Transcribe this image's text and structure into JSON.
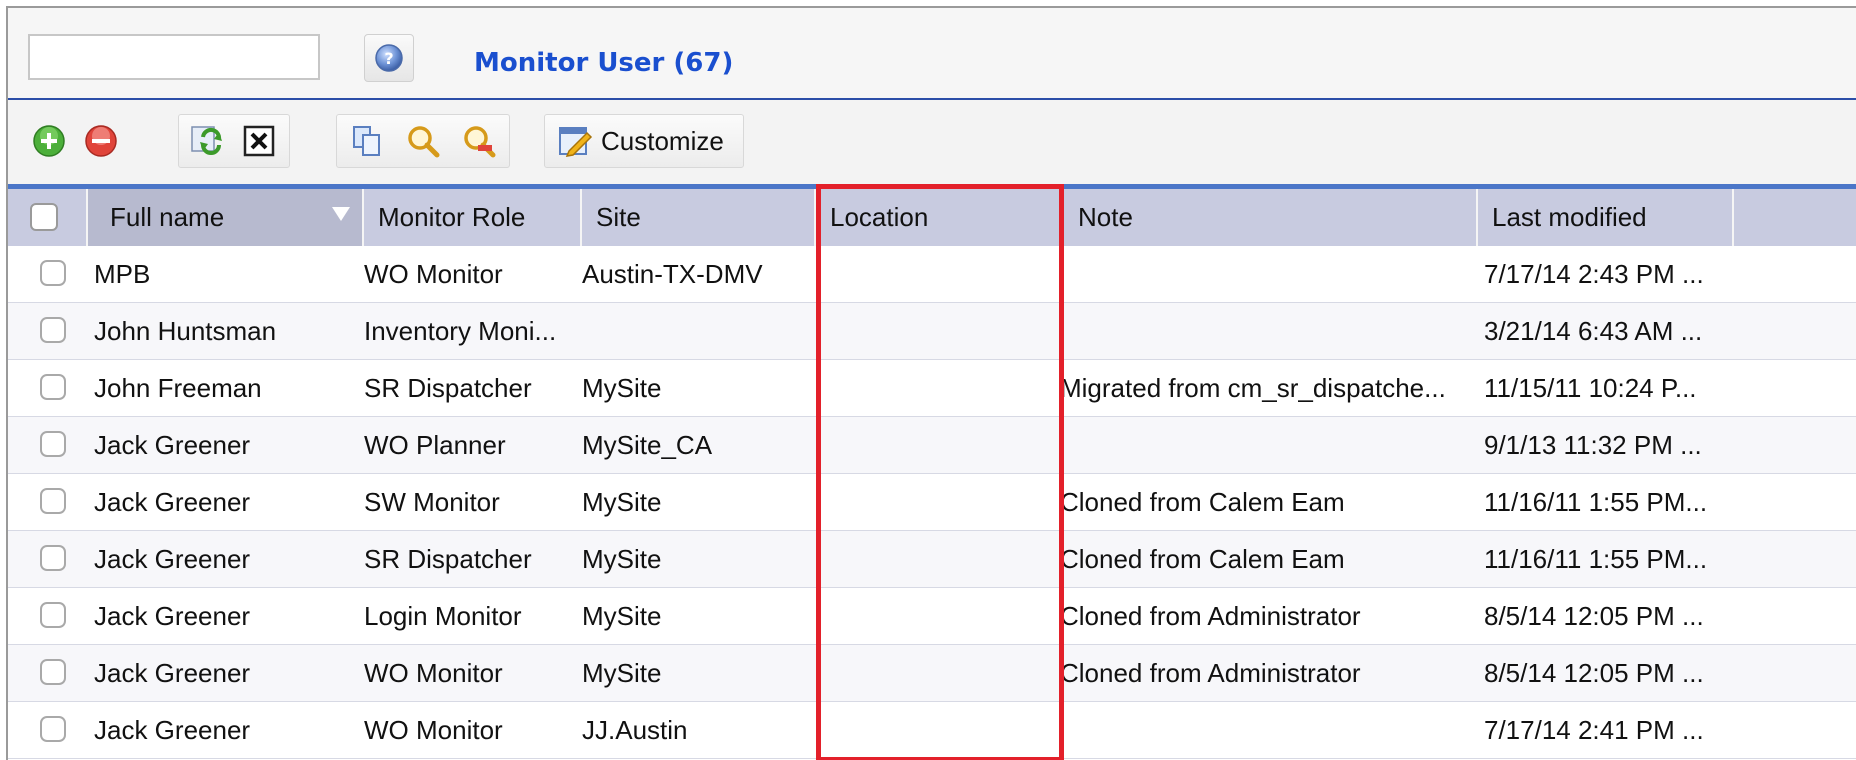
{
  "header": {
    "search_value": "",
    "title": "Monitor User (67)"
  },
  "toolbar": {
    "customize_label": "Customize",
    "icons": [
      "add-icon",
      "delete-icon",
      "refresh-icon",
      "close-icon",
      "copy-icon",
      "search-icon",
      "clear-search-icon",
      "customize-icon"
    ]
  },
  "columns": [
    "Full name",
    "Monitor Role",
    "Site",
    "Location",
    "Note",
    "Last modified"
  ],
  "rows": [
    {
      "name": "MPB",
      "role": "WO Monitor",
      "site": "Austin-TX-DMV",
      "location": "",
      "note": "",
      "modified": "7/17/14 2:43 PM ..."
    },
    {
      "name": "John Huntsman",
      "role": "Inventory Moni...",
      "site": "",
      "location": "",
      "note": "",
      "modified": "3/21/14 6:43 AM ..."
    },
    {
      "name": "John Freeman",
      "role": "SR Dispatcher",
      "site": "MySite",
      "location": "",
      "note": "Migrated from cm_sr_dispatche...",
      "modified": "11/15/11 10:24 P..."
    },
    {
      "name": "Jack Greener",
      "role": "WO Planner",
      "site": "MySite_CA",
      "location": "",
      "note": "",
      "modified": "9/1/13 11:32 PM ..."
    },
    {
      "name": "Jack Greener",
      "role": "SW Monitor",
      "site": "MySite",
      "location": "",
      "note": "Cloned from Calem Eam",
      "modified": "11/16/11 1:55 PM..."
    },
    {
      "name": "Jack Greener",
      "role": "SR Dispatcher",
      "site": "MySite",
      "location": "",
      "note": "Cloned from Calem Eam",
      "modified": "11/16/11 1:55 PM..."
    },
    {
      "name": "Jack Greener",
      "role": "Login Monitor",
      "site": "MySite",
      "location": "",
      "note": "Cloned from Administrator",
      "modified": "8/5/14 12:05 PM ..."
    },
    {
      "name": "Jack Greener",
      "role": "WO Monitor",
      "site": "MySite",
      "location": "",
      "note": "Cloned from Administrator",
      "modified": "8/5/14 12:05 PM ..."
    },
    {
      "name": "Jack Greener",
      "role": "WO Monitor",
      "site": "JJ.Austin",
      "location": "",
      "note": "",
      "modified": "7/17/14 2:41 PM ..."
    }
  ],
  "colors": {
    "title": "#1a4fcf",
    "header_bg": "#c8cbe0",
    "highlight": "#e3202a"
  }
}
